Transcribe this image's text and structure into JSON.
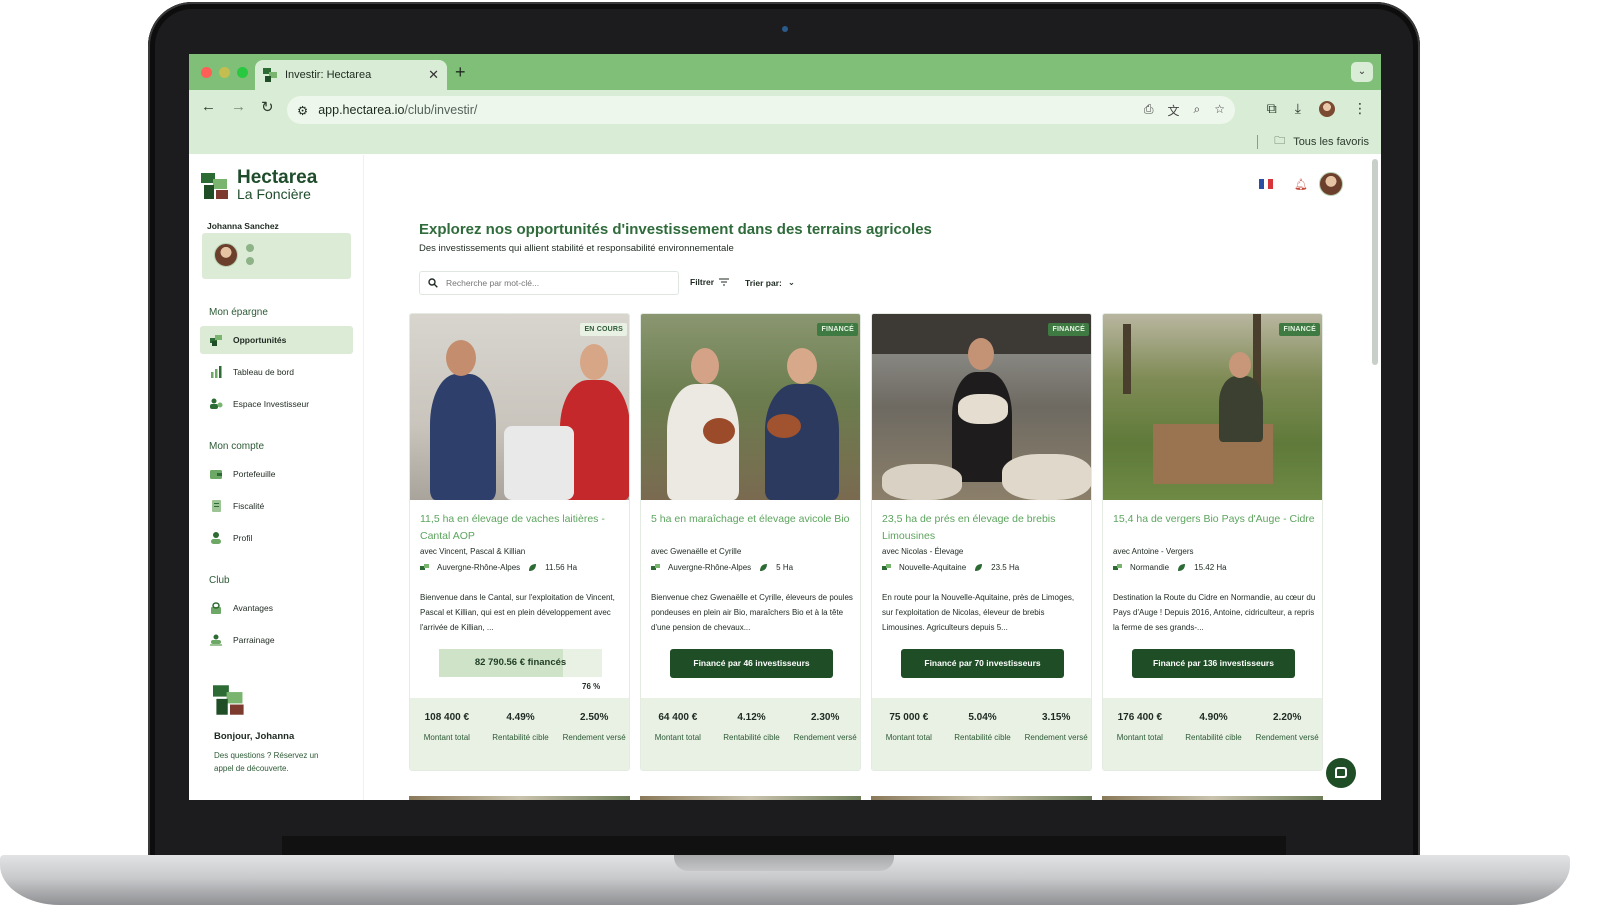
{
  "browser": {
    "tab_title": "Investir: Hectarea",
    "url_host": "app.hectarea.io",
    "url_path": "/club/investir/",
    "bookmarks_label": "Tous les favoris"
  },
  "brand": {
    "name_line1": "Hectarea",
    "name_line2": "La Foncière"
  },
  "user": {
    "name": "Johanna Sanchez"
  },
  "sidebar": {
    "section_savings": "Mon épargne",
    "savings_items": [
      {
        "label": "Opportunités",
        "icon": "opportunities-icon",
        "active": true
      },
      {
        "label": "Tableau de bord",
        "icon": "dashboard-icon",
        "active": false
      },
      {
        "label": "Espace Investisseur",
        "icon": "investor-icon",
        "active": false
      }
    ],
    "section_account": "Mon compte",
    "account_items": [
      {
        "label": "Portefeuille",
        "icon": "wallet-icon"
      },
      {
        "label": "Fiscalité",
        "icon": "tax-document-icon"
      },
      {
        "label": "Profil",
        "icon": "profile-icon"
      }
    ],
    "section_club": "Club",
    "club_items": [
      {
        "label": "Avantages",
        "icon": "benefits-icon"
      },
      {
        "label": "Parrainage",
        "icon": "referral-icon"
      }
    ],
    "greeting": "Bonjour, Johanna",
    "greeting_text": "Des questions ? Réservez un appel de découverte."
  },
  "header": {
    "title": "Explorez nos opportunités d'investissement dans des terrains agricoles",
    "subtitle": "Des investissements qui allient stabilité et responsabilité environnementale",
    "search_placeholder": "Recherche par mot-clé...",
    "filter_label": "Filtrer",
    "sort_label": "Trier par:"
  },
  "colors": {
    "brand_dark": "#1e4d26",
    "brand_green": "#2f6b3b",
    "accent_light": "#e8f1e4",
    "title_green": "#5da45e"
  },
  "cards": [
    {
      "badge": "EN COURS",
      "title": "11,5 ha en élevage de vaches laitières - Cantal AOP",
      "with": "avec Vincent, Pascal & Killian",
      "region": "Auvergne-Rhône-Alpes",
      "area": "11.56 Ha",
      "desc": "Bienvenue dans le Cantal, sur l'exploitation de Vincent, Pascal et Killian, qui est en plein développement avec l'arrivée de Killian, ...",
      "funded_amount": "82 790.56 € financés",
      "progress_pct_label": "76 %",
      "progress": 0.76,
      "total": "108 400 €",
      "target_yield": "4.49%",
      "paid_yield": "2.50%"
    },
    {
      "badge": "FINANCÉ",
      "title": "5 ha en maraîchage et élevage avicole Bio",
      "with": "avec Gwenaëlle et Cyrille",
      "region": "Auvergne-Rhône-Alpes",
      "area": "5 Ha",
      "desc": "Bienvenue chez Gwenaëlle et Cyrille, éleveurs de poules pondeuses en plein air Bio, maraîchers Bio et à la tête d'une pension de chevaux...",
      "funded_button": "Financé par 46 investisseurs",
      "total": "64 400 €",
      "target_yield": "4.12%",
      "paid_yield": "2.30%"
    },
    {
      "badge": "FINANCÉ",
      "title": "23,5 ha de prés en élevage de brebis Limousines",
      "with": "avec Nicolas - Élevage",
      "region": "Nouvelle-Aquitaine",
      "area": "23.5 Ha",
      "desc": "En route pour la Nouvelle-Aquitaine, près de Limoges, sur l'exploitation de Nicolas, éleveur de brebis Limousines. Agriculteurs depuis 5...",
      "funded_button": "Financé par 70 investisseurs",
      "total": "75 000 €",
      "target_yield": "5.04%",
      "paid_yield": "3.15%"
    },
    {
      "badge": "FINANCÉ",
      "title": "15,4 ha de vergers Bio Pays d'Auge - Cidre",
      "with": "avec Antoine - Vergers",
      "region": "Normandie",
      "area": "15.42 Ha",
      "desc": "Destination la Route du Cidre en Normandie, au cœur du Pays d'Auge ! Depuis 2016, Antoine, cidriculteur, a repris la ferme de ses grands-...",
      "funded_button": "Financé par 136 investisseurs",
      "total": "176 400 €",
      "target_yield": "4.90%",
      "paid_yield": "2.20%"
    }
  ],
  "stat_labels": {
    "total": "Montant total",
    "target": "Rentabilité cible",
    "paid": "Rendement versé"
  }
}
